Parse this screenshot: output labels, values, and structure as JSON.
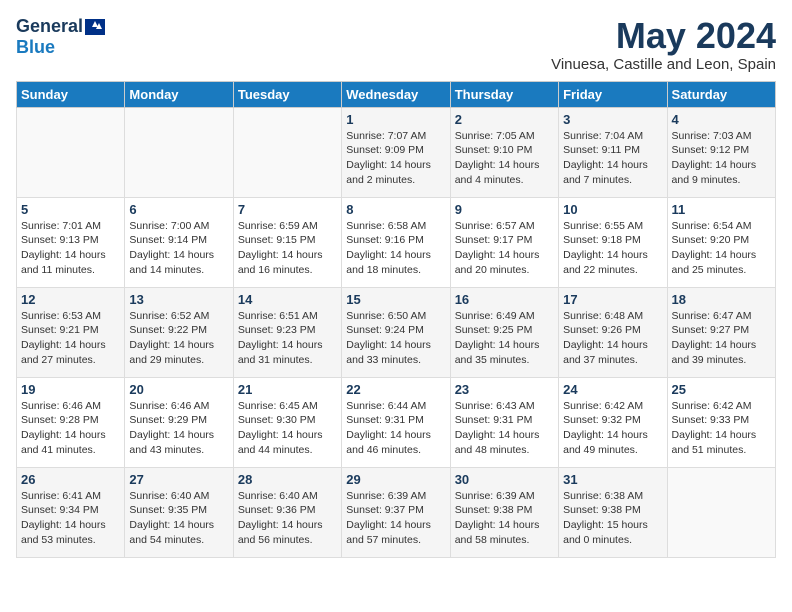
{
  "header": {
    "logo_general": "General",
    "logo_blue": "Blue",
    "title": "May 2024",
    "subtitle": "Vinuesa, Castille and Leon, Spain"
  },
  "days_of_week": [
    "Sunday",
    "Monday",
    "Tuesday",
    "Wednesday",
    "Thursday",
    "Friday",
    "Saturday"
  ],
  "weeks": [
    [
      {
        "day": "",
        "info": ""
      },
      {
        "day": "",
        "info": ""
      },
      {
        "day": "",
        "info": ""
      },
      {
        "day": "1",
        "info": "Sunrise: 7:07 AM\nSunset: 9:09 PM\nDaylight: 14 hours\nand 2 minutes."
      },
      {
        "day": "2",
        "info": "Sunrise: 7:05 AM\nSunset: 9:10 PM\nDaylight: 14 hours\nand 4 minutes."
      },
      {
        "day": "3",
        "info": "Sunrise: 7:04 AM\nSunset: 9:11 PM\nDaylight: 14 hours\nand 7 minutes."
      },
      {
        "day": "4",
        "info": "Sunrise: 7:03 AM\nSunset: 9:12 PM\nDaylight: 14 hours\nand 9 minutes."
      }
    ],
    [
      {
        "day": "5",
        "info": "Sunrise: 7:01 AM\nSunset: 9:13 PM\nDaylight: 14 hours\nand 11 minutes."
      },
      {
        "day": "6",
        "info": "Sunrise: 7:00 AM\nSunset: 9:14 PM\nDaylight: 14 hours\nand 14 minutes."
      },
      {
        "day": "7",
        "info": "Sunrise: 6:59 AM\nSunset: 9:15 PM\nDaylight: 14 hours\nand 16 minutes."
      },
      {
        "day": "8",
        "info": "Sunrise: 6:58 AM\nSunset: 9:16 PM\nDaylight: 14 hours\nand 18 minutes."
      },
      {
        "day": "9",
        "info": "Sunrise: 6:57 AM\nSunset: 9:17 PM\nDaylight: 14 hours\nand 20 minutes."
      },
      {
        "day": "10",
        "info": "Sunrise: 6:55 AM\nSunset: 9:18 PM\nDaylight: 14 hours\nand 22 minutes."
      },
      {
        "day": "11",
        "info": "Sunrise: 6:54 AM\nSunset: 9:20 PM\nDaylight: 14 hours\nand 25 minutes."
      }
    ],
    [
      {
        "day": "12",
        "info": "Sunrise: 6:53 AM\nSunset: 9:21 PM\nDaylight: 14 hours\nand 27 minutes."
      },
      {
        "day": "13",
        "info": "Sunrise: 6:52 AM\nSunset: 9:22 PM\nDaylight: 14 hours\nand 29 minutes."
      },
      {
        "day": "14",
        "info": "Sunrise: 6:51 AM\nSunset: 9:23 PM\nDaylight: 14 hours\nand 31 minutes."
      },
      {
        "day": "15",
        "info": "Sunrise: 6:50 AM\nSunset: 9:24 PM\nDaylight: 14 hours\nand 33 minutes."
      },
      {
        "day": "16",
        "info": "Sunrise: 6:49 AM\nSunset: 9:25 PM\nDaylight: 14 hours\nand 35 minutes."
      },
      {
        "day": "17",
        "info": "Sunrise: 6:48 AM\nSunset: 9:26 PM\nDaylight: 14 hours\nand 37 minutes."
      },
      {
        "day": "18",
        "info": "Sunrise: 6:47 AM\nSunset: 9:27 PM\nDaylight: 14 hours\nand 39 minutes."
      }
    ],
    [
      {
        "day": "19",
        "info": "Sunrise: 6:46 AM\nSunset: 9:28 PM\nDaylight: 14 hours\nand 41 minutes."
      },
      {
        "day": "20",
        "info": "Sunrise: 6:46 AM\nSunset: 9:29 PM\nDaylight: 14 hours\nand 43 minutes."
      },
      {
        "day": "21",
        "info": "Sunrise: 6:45 AM\nSunset: 9:30 PM\nDaylight: 14 hours\nand 44 minutes."
      },
      {
        "day": "22",
        "info": "Sunrise: 6:44 AM\nSunset: 9:31 PM\nDaylight: 14 hours\nand 46 minutes."
      },
      {
        "day": "23",
        "info": "Sunrise: 6:43 AM\nSunset: 9:31 PM\nDaylight: 14 hours\nand 48 minutes."
      },
      {
        "day": "24",
        "info": "Sunrise: 6:42 AM\nSunset: 9:32 PM\nDaylight: 14 hours\nand 49 minutes."
      },
      {
        "day": "25",
        "info": "Sunrise: 6:42 AM\nSunset: 9:33 PM\nDaylight: 14 hours\nand 51 minutes."
      }
    ],
    [
      {
        "day": "26",
        "info": "Sunrise: 6:41 AM\nSunset: 9:34 PM\nDaylight: 14 hours\nand 53 minutes."
      },
      {
        "day": "27",
        "info": "Sunrise: 6:40 AM\nSunset: 9:35 PM\nDaylight: 14 hours\nand 54 minutes."
      },
      {
        "day": "28",
        "info": "Sunrise: 6:40 AM\nSunset: 9:36 PM\nDaylight: 14 hours\nand 56 minutes."
      },
      {
        "day": "29",
        "info": "Sunrise: 6:39 AM\nSunset: 9:37 PM\nDaylight: 14 hours\nand 57 minutes."
      },
      {
        "day": "30",
        "info": "Sunrise: 6:39 AM\nSunset: 9:38 PM\nDaylight: 14 hours\nand 58 minutes."
      },
      {
        "day": "31",
        "info": "Sunrise: 6:38 AM\nSunset: 9:38 PM\nDaylight: 15 hours\nand 0 minutes."
      },
      {
        "day": "",
        "info": ""
      }
    ]
  ]
}
